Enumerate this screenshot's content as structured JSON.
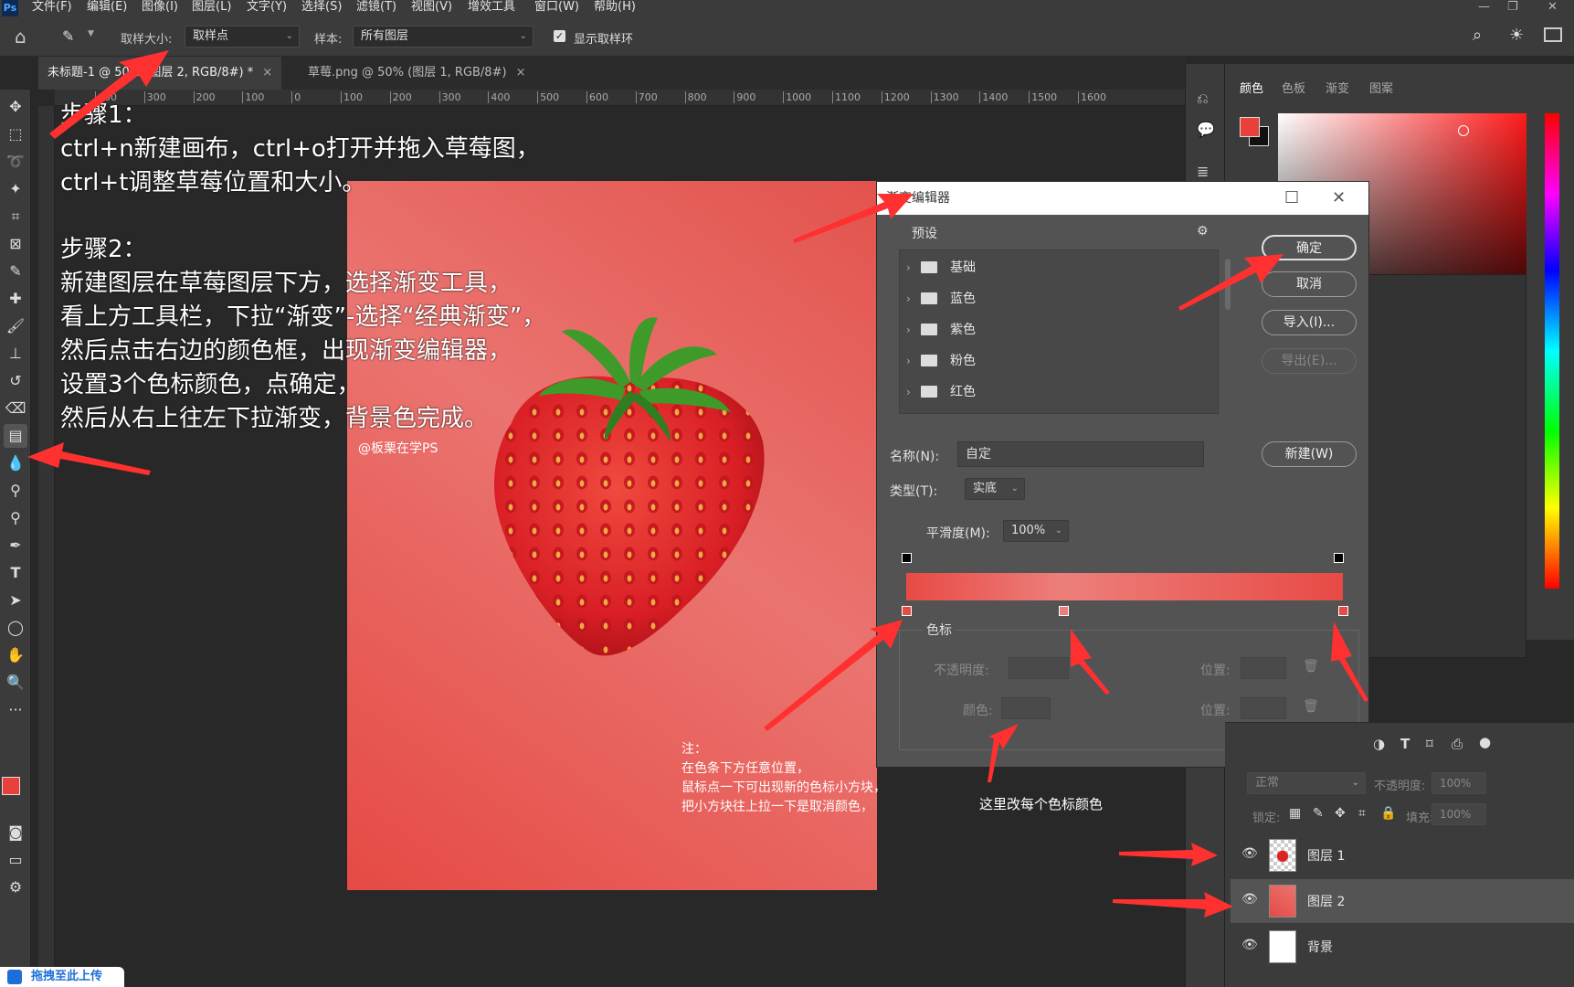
{
  "menu": {
    "items": [
      "文件(F)",
      "编辑(E)",
      "图像(I)",
      "图层(L)",
      "文字(Y)",
      "选择(S)",
      "滤镜(T)",
      "视图(V)",
      "增效工具",
      "窗口(W)",
      "帮助(H)"
    ]
  },
  "options_bar": {
    "sample_size_label": "取样大小:",
    "sample_size_value": "取样点",
    "sample_label": "样本:",
    "sample_value": "所有图层",
    "show_ring_label": "显示取样环"
  },
  "tabs": [
    {
      "label": "未标题-1 @ 50% (图层 2, RGB/8#) *",
      "close": "×"
    },
    {
      "label": "草莓.png @ 50% (图层 1, RGB/8#)",
      "close": "×"
    }
  ],
  "ruler_h": [
    "400",
    "300",
    "200",
    "100",
    "0",
    "100",
    "200",
    "300",
    "400",
    "500",
    "600",
    "700",
    "800",
    "900",
    "1000",
    "1100",
    "1200",
    "1300",
    "1400",
    "1500",
    "1600"
  ],
  "notes": {
    "step1_title": "步骤1：",
    "step1_line1": "ctrl+n新建画布，ctrl+o打开并拖入草莓图，",
    "step1_line2": "ctrl+t调整草莓位置和大小。",
    "step2_title": "步骤2：",
    "step2_line1": "新建图层在草莓图层下方，选择渐变工具，",
    "step2_line2": "看上方工具栏，下拉“渐变”-选择“经典渐变”，",
    "step2_line3": "然后点击右边的颜色框，出现渐变编辑器，",
    "step2_line4": "设置3个色标颜色，点确定，",
    "step2_line5": "然后从右上往左下拉渐变，背景色完成。",
    "watermark": "@板栗在学PS",
    "tip_title": "注：",
    "tip_line1": "在色条下方任意位置，",
    "tip_line2": "鼠标点一下可出现新的色标小方块，",
    "tip_line3": "把小方块往上拉一下是取消颜色，",
    "stop_color_tip": "这里改每个色标颜色"
  },
  "color_panel": {
    "tabs": [
      "颜色",
      "色板",
      "渐变",
      "图案"
    ],
    "fg_color": "#e8403a",
    "bg_color": "#111111"
  },
  "dialog": {
    "title": "渐变编辑器",
    "presets_label": "预设",
    "presets": [
      "基础",
      "蓝色",
      "紫色",
      "粉色",
      "红色"
    ],
    "ok": "确定",
    "cancel": "取消",
    "import": "导入(I)...",
    "export": "导出(E)...",
    "name_label": "名称(N):",
    "name_value": "自定",
    "new": "新建(W)",
    "type_label": "类型(T):",
    "type_value": "实底",
    "smooth_label": "平滑度(M):",
    "smooth_value": "100%",
    "stops_group": "色标",
    "opacity_label": "不透明度:",
    "position_label": "位置:",
    "color_label": "颜色:",
    "gradient_stops": [
      {
        "position": 0,
        "color": "#e84a45"
      },
      {
        "position": 0.36,
        "color": "#ec7f7b"
      },
      {
        "position": 1,
        "color": "#e84a45"
      }
    ]
  },
  "layers": {
    "blend_mode": "正常",
    "opacity_label": "不透明度:",
    "opacity_value": "100%",
    "lock_label": "锁定:",
    "fill_label": "填充:",
    "fill_value": "100%",
    "items": [
      {
        "name": "图层 1",
        "selected": false
      },
      {
        "name": "图层 2",
        "selected": true
      },
      {
        "name": "背景",
        "selected": false
      }
    ]
  },
  "upload_badge": "拖拽至此上传"
}
